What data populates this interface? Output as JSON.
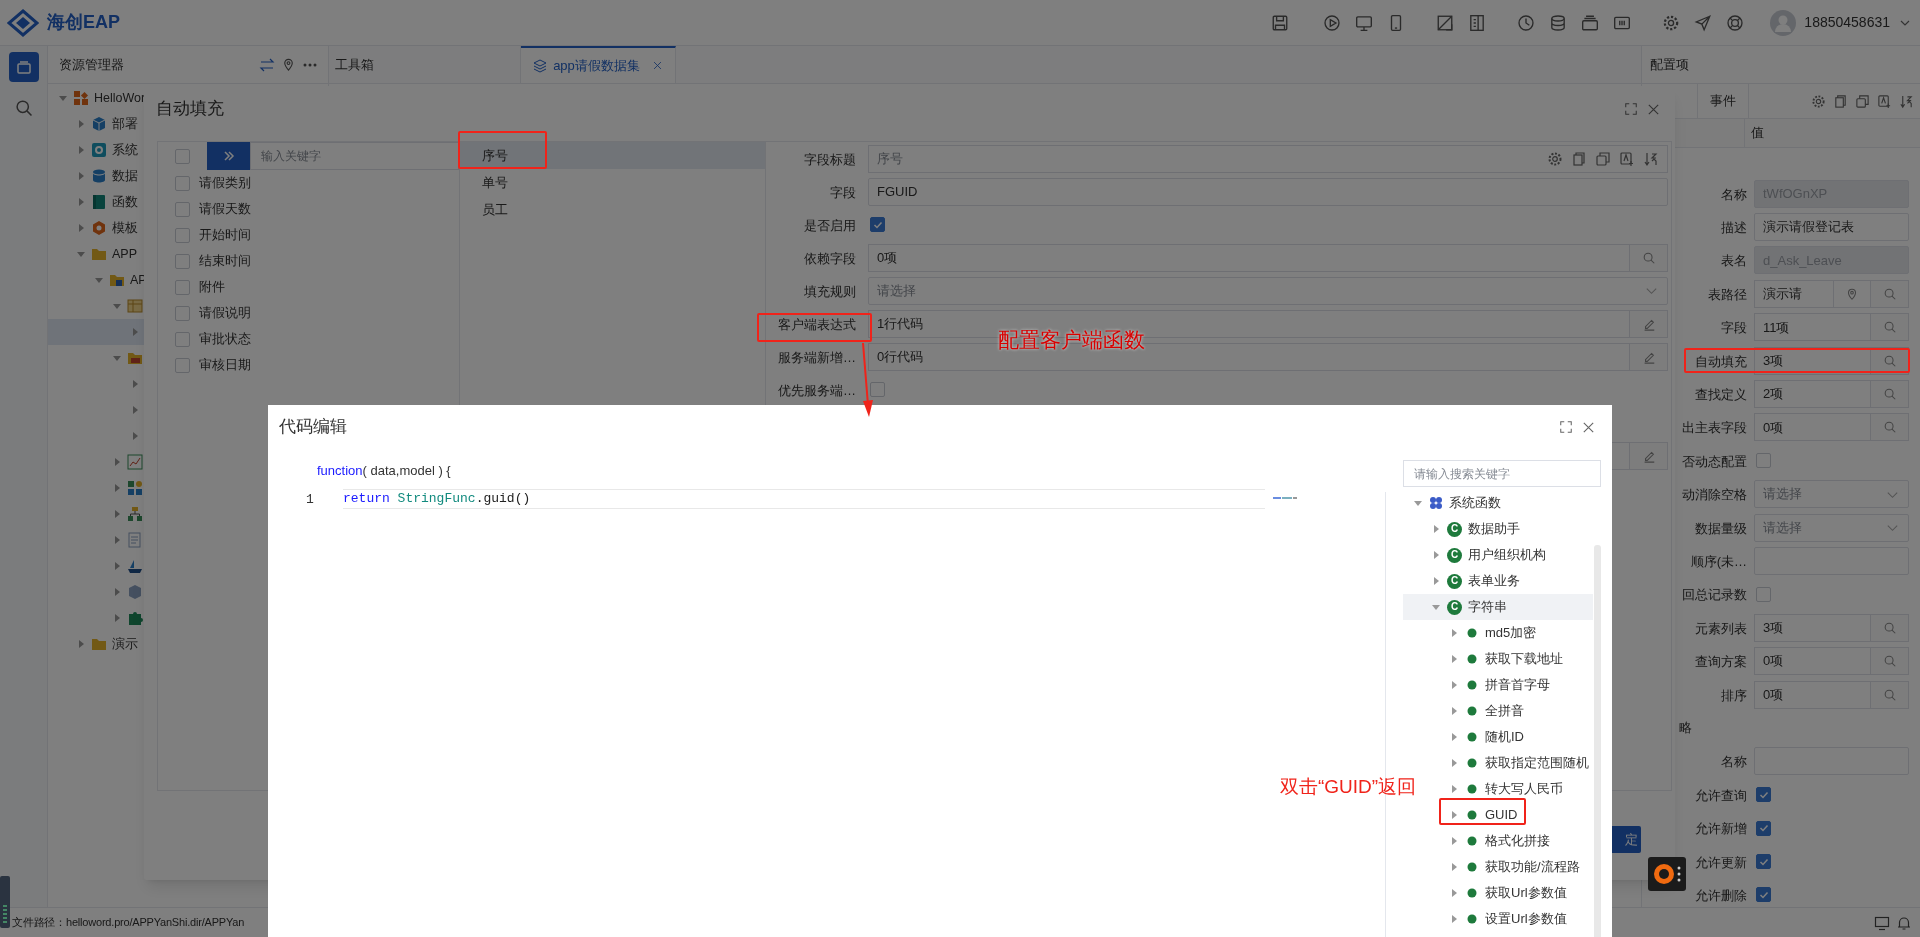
{
  "app": {
    "logo": "海创EAP",
    "user": "18850458631"
  },
  "explorer": {
    "title": "资源管理器",
    "tree": [
      {
        "label": "HelloWor",
        "kind": "grid",
        "expanded": true,
        "selected": false,
        "children": [
          {
            "label": "部署",
            "kind": "cube",
            "expanded": false,
            "selected": false
          },
          {
            "label": "系统",
            "kind": "gear",
            "expanded": false,
            "selected": false
          },
          {
            "label": "数据",
            "kind": "database",
            "expanded": false,
            "selected": false
          },
          {
            "label": "函数",
            "kind": "book",
            "expanded": false,
            "selected": false
          },
          {
            "label": "模板",
            "kind": "hexagon",
            "expanded": false,
            "selected": false
          },
          {
            "label": "APP",
            "kind": "folder",
            "expanded": true,
            "selected": false,
            "children": [
              {
                "label": "AP",
                "kind": "appfolder",
                "expanded": true,
                "selected": false,
                "children": [
                  {
                    "kind": "table",
                    "expanded": true,
                    "selected": false,
                    "children": [
                      {
                        "expanded": false,
                        "selected": true
                      }
                    ]
                  },
                  {
                    "kind": "folderopen",
                    "expanded": true,
                    "selected": false,
                    "children": [
                      {
                        "expanded": false,
                        "selected": false
                      },
                      {
                        "expanded": false,
                        "selected": false
                      },
                      {
                        "expanded": false,
                        "selected": false
                      }
                    ]
                  },
                  {
                    "kind": "chart",
                    "expanded": false,
                    "selected": false
                  },
                  {
                    "kind": "shapes",
                    "expanded": false,
                    "selected": false
                  },
                  {
                    "kind": "flowchart",
                    "expanded": false,
                    "selected": false
                  },
                  {
                    "kind": "document",
                    "expanded": false,
                    "selected": false
                  },
                  {
                    "kind": "ship",
                    "expanded": false,
                    "selected": false
                  },
                  {
                    "kind": "box",
                    "expanded": false,
                    "selected": false
                  },
                  {
                    "kind": "puzzle",
                    "expanded": false,
                    "selected": false
                  }
                ]
              }
            ]
          },
          {
            "label": "演示",
            "kind": "folder",
            "expanded": false,
            "selected": false
          }
        ]
      }
    ]
  },
  "tabs": [
    {
      "label": "工具箱",
      "selected": false
    },
    {
      "label": "app请假数据集",
      "selected": true
    }
  ],
  "config_panel": {
    "title": "配置项",
    "tabs": [
      {
        "label": "事件",
        "selected": false
      }
    ],
    "column_header": "值",
    "rows": [
      {
        "label": "名称",
        "kind": "text",
        "value": "tWfOGnXP",
        "disabled": true
      },
      {
        "label": "描述",
        "kind": "text",
        "value": "演示请假登记表",
        "disabled": false
      },
      {
        "label": "表名",
        "kind": "text",
        "value": "d_Ask_Leave",
        "disabled": true
      },
      {
        "label": "表路径",
        "kind": "path",
        "value": "演示请"
      },
      {
        "label": "字段",
        "kind": "lookup",
        "value": "11项"
      },
      {
        "label": "自动填充",
        "kind": "lookup",
        "value": "3项"
      },
      {
        "label": "查找定义",
        "kind": "lookup",
        "value": "2项"
      },
      {
        "label": "出主表字段",
        "kind": "lookup",
        "value": "0项"
      },
      {
        "label": "否动态配置",
        "kind": "check",
        "checked": false
      },
      {
        "label": "动消除空格",
        "kind": "select",
        "placeholder": "请选择"
      },
      {
        "label": "数据量级",
        "kind": "select",
        "placeholder": "请选择"
      },
      {
        "label": "顺序(未…",
        "kind": "text",
        "disabled": false
      },
      {
        "label": "回总记录数",
        "kind": "check",
        "checked": false
      },
      {
        "label": "元素列表",
        "kind": "lookup",
        "value": "3项"
      },
      {
        "label": "查询方案",
        "kind": "lookup",
        "value": "0项"
      },
      {
        "label": "排序",
        "kind": "lookup",
        "value": "0项"
      },
      {
        "label": "略",
        "kind": "section"
      },
      {
        "label": "名称",
        "kind": "text",
        "disabled": false
      },
      {
        "label": "允许查询",
        "kind": "check",
        "checked": true
      },
      {
        "label": "允许新增",
        "kind": "check",
        "checked": true
      },
      {
        "label": "允许更新",
        "kind": "check",
        "checked": true
      },
      {
        "label": "允许删除",
        "kind": "check",
        "checked": true
      }
    ]
  },
  "status_bar": {
    "path": "文件路径：helloword.pro/APPYanShi.dir/APPYan"
  },
  "autofill_dialog": {
    "title": "自动填充",
    "select_all": false,
    "search_placeholder": "输入关键字",
    "fields": [
      {
        "label": "请假类别",
        "checked": false
      },
      {
        "label": "请假天数",
        "checked": false
      },
      {
        "label": "开始时间",
        "checked": false
      },
      {
        "label": "结束时间",
        "checked": false
      },
      {
        "label": "附件",
        "checked": false
      },
      {
        "label": "请假说明",
        "checked": false
      },
      {
        "label": "审批状态",
        "checked": false
      },
      {
        "label": "审核日期",
        "checked": false
      }
    ],
    "selected_fields": [
      {
        "label": "序号",
        "selected": true
      },
      {
        "label": "单号",
        "selected": false
      },
      {
        "label": "员工",
        "selected": false
      }
    ],
    "form": [
      {
        "label": "字段标题",
        "kind": "title",
        "placeholder": "序号"
      },
      {
        "label": "字段",
        "kind": "text",
        "value": "FGUID",
        "disabled": false
      },
      {
        "label": "是否启用",
        "kind": "check",
        "checked": true
      },
      {
        "label": "依赖字段",
        "kind": "lookup",
        "value": "0项"
      },
      {
        "label": "填充规则",
        "kind": "select",
        "placeholder": "请选择"
      },
      {
        "label": "客户端表达式",
        "kind": "code",
        "value": "1行代码"
      },
      {
        "label": "服务端新增…",
        "kind": "code",
        "value": "0行代码"
      },
      {
        "label": "优先服务端…",
        "kind": "check",
        "checked": false
      },
      {
        "kind": "code"
      }
    ],
    "confirm_button": "定"
  },
  "code_editor": {
    "title": "代码编辑",
    "signature": {
      "keyword": "function",
      "rest": "( data,model ) {"
    },
    "lines": [
      {
        "number": "1",
        "tokens": [
          {
            "text": "return ",
            "kind": "keyword"
          },
          {
            "text": "StringFunc",
            "kind": "type"
          },
          {
            "text": ".guid()",
            "kind": "plain"
          }
        ]
      }
    ],
    "search_placeholder": "请输入搜索关键字",
    "tree": [
      {
        "label": "系统函数",
        "kind": "group",
        "expanded": true,
        "selected": false,
        "children": [
          {
            "label": "数据助手",
            "kind": "class",
            "badge": "C",
            "expanded": false,
            "selected": false
          },
          {
            "label": "用户组织机构",
            "kind": "class",
            "badge": "C",
            "expanded": false,
            "selected": false
          },
          {
            "label": "表单业务",
            "kind": "class",
            "badge": "C",
            "expanded": false,
            "selected": false
          },
          {
            "label": "字符串",
            "kind": "class",
            "badge": "C",
            "expanded": true,
            "selected": true,
            "children": [
              {
                "label": "md5加密",
                "kind": "method",
                "expanded": false,
                "selected": false
              },
              {
                "label": "获取下载地址",
                "kind": "method",
                "expanded": false,
                "selected": false
              },
              {
                "label": "拼音首字母",
                "kind": "method",
                "expanded": false,
                "selected": false
              },
              {
                "label": "全拼音",
                "kind": "method",
                "expanded": false,
                "selected": false
              },
              {
                "label": "随机ID",
                "kind": "method",
                "expanded": false,
                "selected": false
              },
              {
                "label": "获取指定范围随机",
                "kind": "method",
                "expanded": false,
                "selected": false
              },
              {
                "label": "转大写人民币",
                "kind": "method",
                "expanded": false,
                "selected": false
              },
              {
                "label": "GUID",
                "kind": "method",
                "expanded": false,
                "selected": false
              },
              {
                "label": "格式化拼接",
                "kind": "method",
                "expanded": false,
                "selected": false
              },
              {
                "label": "获取功能/流程路",
                "kind": "method",
                "expanded": false,
                "selected": false
              },
              {
                "label": "获取Url参数值",
                "kind": "method",
                "expanded": false,
                "selected": false
              },
              {
                "label": "设置Url参数值",
                "kind": "method",
                "expanded": false,
                "selected": false
              }
            ]
          }
        ]
      }
    ]
  },
  "annotations": {
    "notes": [
      "配置客户端函数",
      "双击“GUID”返回"
    ]
  }
}
